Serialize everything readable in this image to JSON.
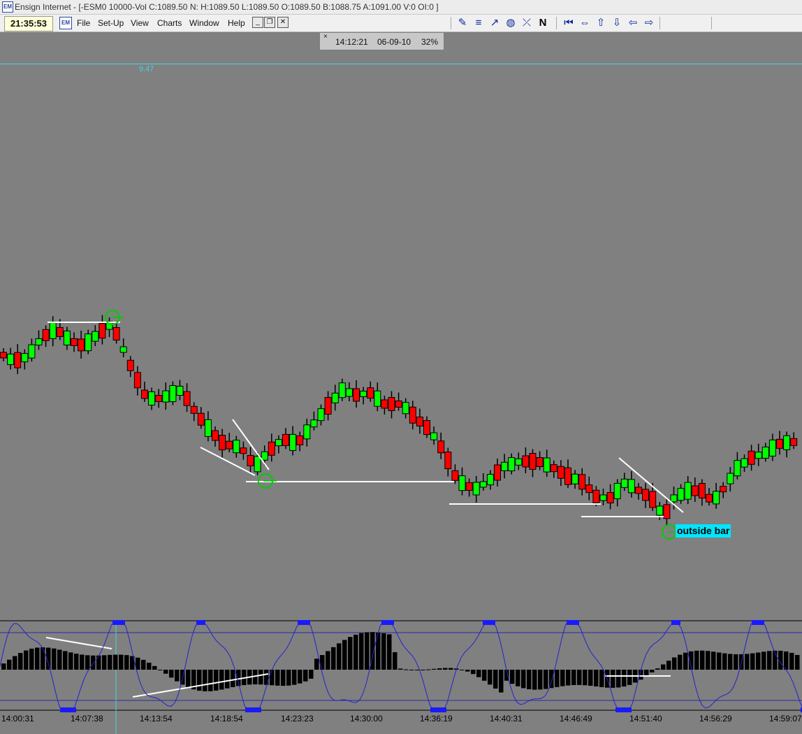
{
  "window": {
    "app_icon": "EM",
    "title": "Ensign Internet - [-ESM0 10000-Vol C:1089.50 N: H:1089.50 L:1089.50 O:1089.50 B:1088.75 A:1091.00 V:0 OI:0 ]"
  },
  "menubar": {
    "clock": "21:35:53",
    "items": [
      "File",
      "Set-Up",
      "View",
      "Charts",
      "Window",
      "Help"
    ],
    "window_buttons": [
      "_",
      "❐",
      "✕"
    ],
    "tools": [
      {
        "name": "pencil-icon",
        "glyph": "✎"
      },
      {
        "name": "fib-lines-icon",
        "glyph": "≡"
      },
      {
        "name": "trend-tool-icon",
        "glyph": "↗"
      },
      {
        "name": "cycle-tool-icon",
        "glyph": "◍"
      },
      {
        "name": "cross-tool-icon",
        "glyph": "⤫"
      },
      {
        "name": "n-tool-icon",
        "glyph": "N"
      }
    ],
    "nav": [
      {
        "name": "first-icon",
        "glyph": "⏮"
      },
      {
        "name": "expand-icon",
        "glyph": "⇔"
      },
      {
        "name": "up-arrow-icon",
        "glyph": "⇧"
      },
      {
        "name": "down-arrow-icon",
        "glyph": "⇩"
      },
      {
        "name": "left-arrow-icon",
        "glyph": "⇦"
      },
      {
        "name": "right-arrow-icon",
        "glyph": "⇨"
      }
    ]
  },
  "info_box": {
    "close": "×",
    "time": "14:12:21",
    "date": "06-09-10",
    "zoom": "32%"
  },
  "price_marker": "9.47",
  "annotation": "outside bar",
  "time_axis": [
    "14:00:31",
    "14:07:38",
    "14:13:54",
    "14:18:54",
    "14:23:23",
    "14:30:00",
    "14:36:19",
    "14:40:31",
    "14:46:49",
    "14:51:40",
    "14:56:29",
    "14:59:07"
  ],
  "colors": {
    "up": "#00ff00",
    "down": "#ff0000",
    "background": "#808080",
    "oscillator": "#2222cc",
    "highlight": "#00e6ff"
  }
}
